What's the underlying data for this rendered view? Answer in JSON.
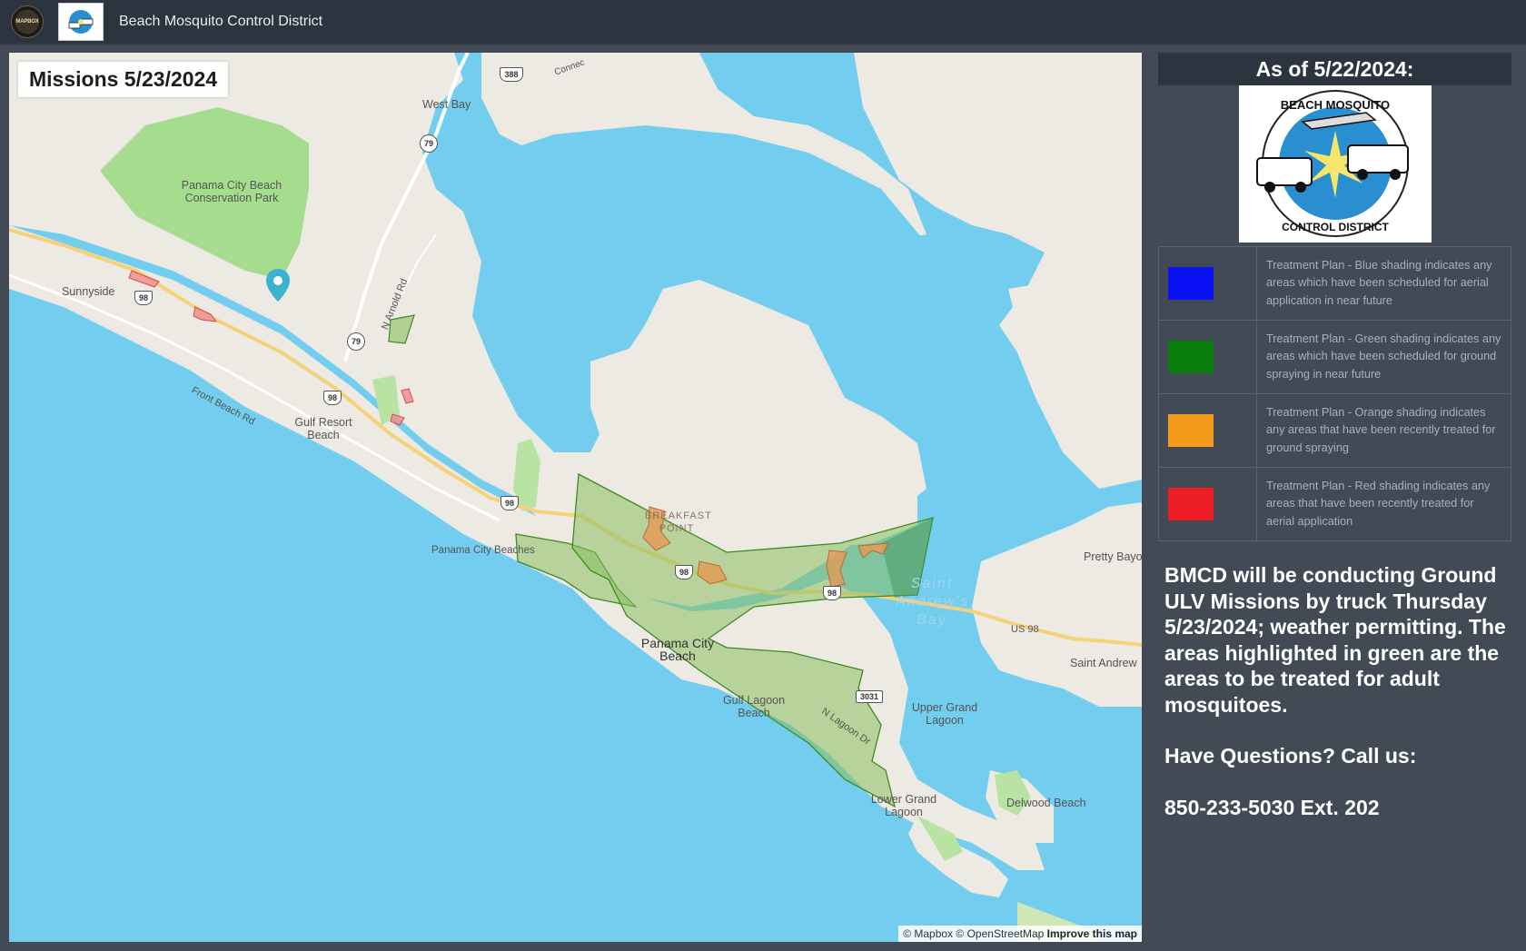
{
  "header": {
    "title": "Beach Mosquito Control District",
    "badge1_text": "MAPBOX"
  },
  "map": {
    "mission_label": "Missions 5/23/2024",
    "attribution": {
      "mapbox": "© Mapbox",
      "osm": "© OpenStreetMap",
      "improve": "Improve this map"
    },
    "places": {
      "west_bay": "West Bay",
      "conservation_park": "Panama City Beach Conservation Park",
      "sunnyside": "Sunnyside",
      "gulf_resort": "Gulf Resort Beach",
      "panama_city_beaches": "Panama City Beaches",
      "breakfast_point": "BREAKFAST POINT",
      "panama_city_beach": "Panama City Beach",
      "gulf_lagoon": "Gulf Lagoon Beach",
      "upper_grand": "Upper Grand Lagoon",
      "lower_grand": "Lower Grand Lagoon",
      "delwood": "Delwood Beach",
      "pretty_bayou": "Pretty Bayo",
      "saint_andrew": "Saint Andrew",
      "saint_andrews_bay": "Saint Andrew's Bay",
      "front_beach_rd": "Front Beach Rd",
      "n_arnold_rd": "N Arnold Rd",
      "n_lagoon_dr": "N Lagoon Dr",
      "us98": "US 98",
      "connector": "Connec"
    },
    "shields": {
      "r388": "388",
      "r79a": "79",
      "r79b": "79",
      "r98a": "98",
      "r98b": "98",
      "r98c": "98",
      "r98d": "98",
      "r98e": "98",
      "r3031": "3031"
    }
  },
  "side": {
    "as_of": "As of 5/22/2024:",
    "logo_top": "BEACH MOSQUITO",
    "logo_bottom": "CONTROL DISTRICT",
    "legend": [
      {
        "color": "#0a12f5",
        "text": "Treatment Plan - Blue shading indicates any areas which have been scheduled for aerial application in near future"
      },
      {
        "color": "#097d0e",
        "text": "Treatment Plan - Green shading indicates any areas which have been scheduled for ground spraying in near future"
      },
      {
        "color": "#f29b1c",
        "text": "Treatment Plan - Orange shading indicates any areas that have been recently treated for ground spraying"
      },
      {
        "color": "#ec1d25",
        "text": "Treatment Plan - Red shading indicates any areas that have been recently treated for aerial application"
      }
    ],
    "message": "BMCD will be conducting Ground ULV Missions by truck Thursday 5/23/2024; weather permitting. The areas highlighted in green are the areas to be treated for adult mosquitoes.",
    "questions": "Have Questions? Call us:",
    "phone": "850-233-5030 Ext. 202"
  }
}
